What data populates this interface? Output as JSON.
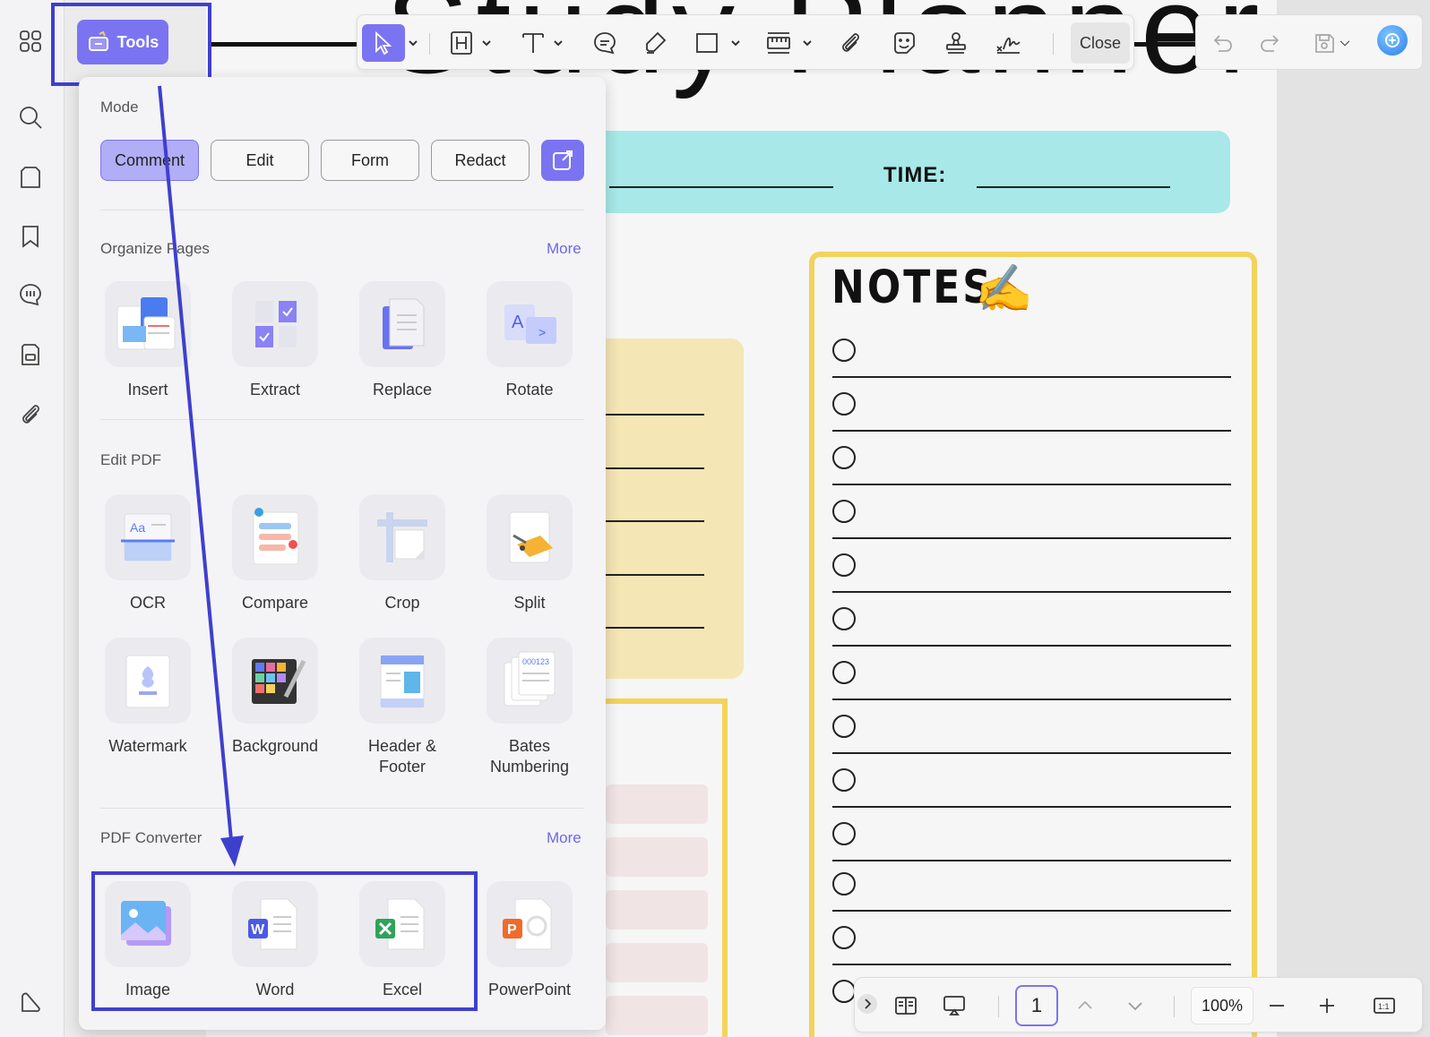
{
  "tools_button": {
    "label": "Tools"
  },
  "panel": {
    "mode": {
      "title": "Mode",
      "buttons": [
        "Comment",
        "Edit",
        "Form",
        "Redact"
      ]
    },
    "organize": {
      "title": "Organize Pages",
      "more": "More",
      "tools": [
        "Insert",
        "Extract",
        "Replace",
        "Rotate"
      ]
    },
    "edit": {
      "title": "Edit PDF",
      "tools": [
        "OCR",
        "Compare",
        "Crop",
        "Split",
        "Watermark",
        "Background",
        "Header & Footer",
        "Bates Numbering"
      ]
    },
    "converter": {
      "title": "PDF Converter",
      "more": "More",
      "tools": [
        "Image",
        "Word",
        "Excel",
        "PowerPoint"
      ]
    }
  },
  "toolbar": {
    "close": "Close"
  },
  "document": {
    "title": "Study Planner",
    "time_label": "TIME:",
    "notes_label": "NOTES:",
    "notes_emoji": "✍️"
  },
  "bottom_bar": {
    "page": "1",
    "zoom": "100%"
  },
  "colors": {
    "accent": "#7b74f2",
    "highlight": "#3f3fce",
    "notes_border": "#f2d35b",
    "band": "#a8e8e8"
  }
}
